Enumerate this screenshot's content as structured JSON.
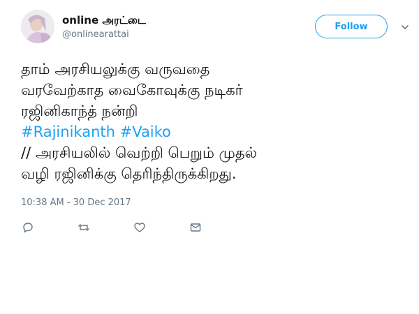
{
  "user": {
    "display_name": "online அரட்டை",
    "handle": "@onlinearattai",
    "avatar_icon": "profile-photo"
  },
  "follow_button": {
    "label": "Follow"
  },
  "menu": {
    "icon": "chevron-down-icon"
  },
  "tweet": {
    "line1": "தாம் அரசியலுக்கு வருவதை",
    "line2": "வரவேற்காத வைகோவுக்கு நடிகர்",
    "line3": "ரஜினிகாந்த் நன்றி",
    "hashtag1": "#Rajinikanth",
    "hashtag2": "#Vaiko",
    "line5": "// அரசியலில் வெற்றி பெறும் முதல்",
    "line6": "வழி ரஜினிக்கு தெரிந்திருக்கிறது."
  },
  "timestamp": "10:38 AM - 30 Dec 2017",
  "actions": {
    "reply_icon": "reply-icon",
    "retweet_icon": "retweet-icon",
    "like_icon": "heart-icon",
    "dm_icon": "envelope-icon"
  },
  "colors": {
    "accent": "#1da1f2",
    "text": "#14171a",
    "muted": "#657786"
  }
}
